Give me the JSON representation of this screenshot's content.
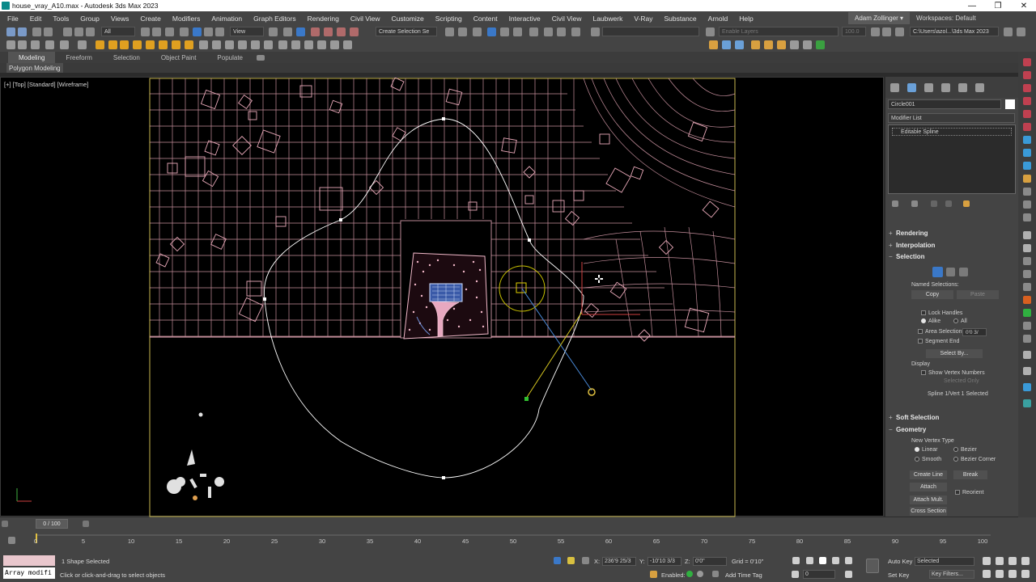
{
  "window": {
    "title": "house_vray_A10.max - Autodesk 3ds Max 2023",
    "minimize": "—",
    "maximize": "❐",
    "close": "✕"
  },
  "menu": {
    "items": [
      "File",
      "Edit",
      "Tools",
      "Group",
      "Views",
      "Create",
      "Modifiers",
      "Animation",
      "Graph Editors",
      "Rendering",
      "Civil View",
      "Customize",
      "Scripting",
      "Content",
      "Interactive",
      "Civil View",
      "Laubwerk",
      "V-Ray",
      "Substance",
      "Arnold",
      "Help"
    ],
    "user": "Adam Zollinger ▾",
    "workspaces_label": "Workspaces:",
    "workspace": "Default"
  },
  "toolbar": {
    "filter": "All",
    "view": "View",
    "selection_set": "Create Selection Se",
    "layers": "Enable Layers",
    "zoom_value": "100.0",
    "path": "C:\\Users\\azol...\\3ds Max 2023"
  },
  "ribbon": {
    "tabs": [
      "Modeling",
      "Freeform",
      "Selection",
      "Object Paint",
      "Populate"
    ],
    "active_tab": "Modeling",
    "sub_label": "Polygon Modeling"
  },
  "viewport": {
    "label": "[+] [Top] [Standard] [Wireframe]",
    "colors": {
      "grid": "#e8a8b8",
      "spline": "#ffffff",
      "border": "#c8b850",
      "light": "#c8c000"
    }
  },
  "command_panel": {
    "object_name": "Circle001",
    "modifier_list": "Modifier List",
    "stack_item": "Editable Spline",
    "rollouts": {
      "rendering": "Rendering",
      "interpolation": "Interpolation",
      "selection": "Selection",
      "soft_selection": "Soft Selection",
      "geometry": "Geometry"
    },
    "selection": {
      "named_selections": "Named Selections:",
      "copy": "Copy",
      "paste": "Paste",
      "lock_handles": "Lock Handles",
      "alike": "Alike",
      "all": "All",
      "area_selection": "Area Selection:",
      "area_value": "0'0 3/",
      "segment_end": "Segment End",
      "select_by": "Select By...",
      "display": "Display",
      "show_vertex_numbers": "Show Vertex Numbers",
      "selected_only": "Selected Only",
      "status": "Spline 1/Vert 1 Selected"
    },
    "geometry": {
      "new_vertex_type": "New Vertex Type",
      "linear": "Linear",
      "bezier": "Bezier",
      "smooth": "Smooth",
      "bezier_corner": "Bezier Corner",
      "create_line": "Create Line",
      "break": "Break",
      "attach": "Attach",
      "reorient": "Reorient",
      "attach_mult": "Attach Mult.",
      "cross_section": "Cross Section"
    }
  },
  "timeline": {
    "frame": "0 / 100",
    "ticks": [
      "0",
      "5",
      "10",
      "15",
      "20",
      "25",
      "30",
      "35",
      "40",
      "45",
      "50",
      "55",
      "60",
      "65",
      "70",
      "75",
      "80",
      "85",
      "90",
      "95",
      "100"
    ]
  },
  "status": {
    "maxscript": "Array modifi",
    "selection_count": "1 Shape Selected",
    "prompt": "Click or click-and-drag to select objects",
    "x_label": "X:",
    "x_value": "236'9 25/3",
    "y_label": "Y:",
    "y_value": "-10'10 3/3",
    "z_label": "Z:",
    "z_value": "0'0\"",
    "grid": "Grid = 0'10\"",
    "enabled": "Enabled:",
    "add_time_tag": "Add Time Tag",
    "auto_key": "Auto Key",
    "set_key": "Set Key",
    "key_filter": "Selected",
    "key_filters": "Key Filters...",
    "frame_value": "0"
  }
}
